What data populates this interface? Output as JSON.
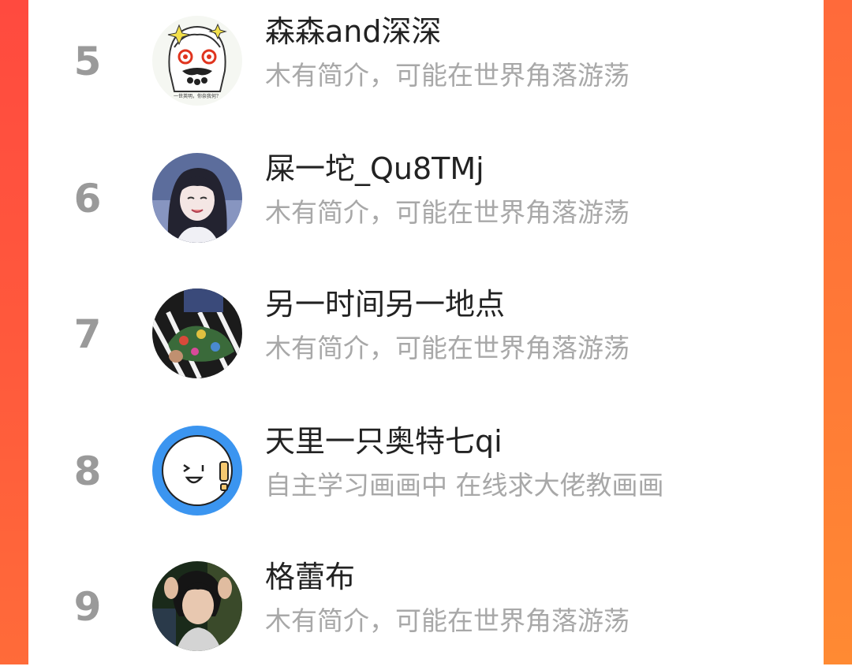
{
  "colors": {
    "background_left": "#ff4a3f",
    "background_right": "#ff7a36",
    "card": "#ffffff",
    "rank_text": "#9a9a9a",
    "name_text": "#222222",
    "bio_text": "#a8a8a8"
  },
  "users": [
    {
      "rank": "5",
      "name": "森森and深深",
      "bio": "木有简介，可能在世界角落游荡",
      "avatar_icon": "cartoon-girl-avatar-icon",
      "avatar_caption": "一世英明，你奈我何？"
    },
    {
      "rank": "6",
      "name": "屎一坨_Qu8TMj",
      "bio": "木有简介，可能在世界角落游荡",
      "avatar_icon": "anime-girl-avatar-icon"
    },
    {
      "rank": "7",
      "name": "另一时间另一地点",
      "bio": "木有简介，可能在世界角落游荡",
      "avatar_icon": "photo-avatar-icon"
    },
    {
      "rank": "8",
      "name": "天里一只奥特七qi",
      "bio": "自主学习画画中 在线求大佬教画画",
      "avatar_icon": "smiley-face-avatar-icon"
    },
    {
      "rank": "9",
      "name": "格蕾布",
      "bio": "木有简介，可能在世界角落游荡",
      "avatar_icon": "portrait-avatar-icon"
    }
  ]
}
